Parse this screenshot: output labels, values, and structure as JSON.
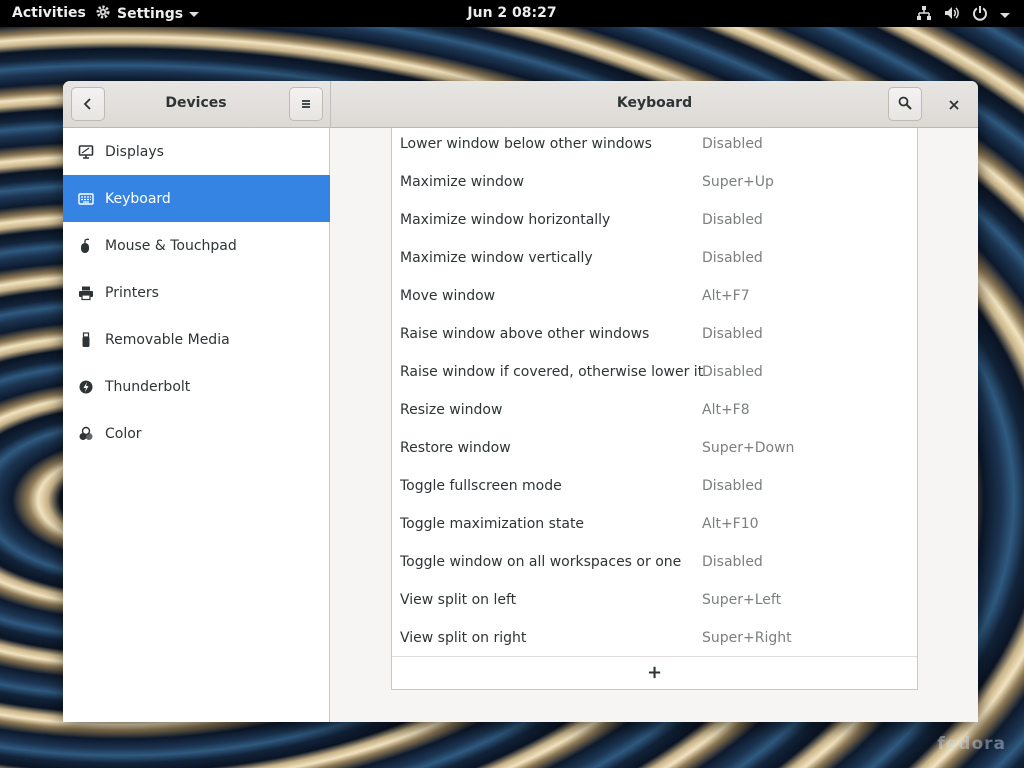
{
  "topbar": {
    "activities": "Activities",
    "app_name": "Settings",
    "clock": "Jun 2  08:27"
  },
  "window": {
    "sidebar_title": "Devices",
    "content_title": "Keyboard",
    "sidebar": {
      "items": [
        {
          "label": "Displays",
          "icon": "display-icon"
        },
        {
          "label": "Keyboard",
          "icon": "keyboard-icon",
          "active": true
        },
        {
          "label": "Mouse & Touchpad",
          "icon": "mouse-icon"
        },
        {
          "label": "Printers",
          "icon": "printer-icon"
        },
        {
          "label": "Removable Media",
          "icon": "usb-icon"
        },
        {
          "label": "Thunderbolt",
          "icon": "thunderbolt-icon"
        },
        {
          "label": "Color",
          "icon": "color-icon"
        }
      ]
    },
    "shortcuts": [
      {
        "name": "Lower window below other windows",
        "accel": "Disabled"
      },
      {
        "name": "Maximize window",
        "accel": "Super+Up"
      },
      {
        "name": "Maximize window horizontally",
        "accel": "Disabled"
      },
      {
        "name": "Maximize window vertically",
        "accel": "Disabled"
      },
      {
        "name": "Move window",
        "accel": "Alt+F7"
      },
      {
        "name": "Raise window above other windows",
        "accel": "Disabled"
      },
      {
        "name": "Raise window if covered, otherwise lower it",
        "accel": "Disabled"
      },
      {
        "name": "Resize window",
        "accel": "Alt+F8"
      },
      {
        "name": "Restore window",
        "accel": "Super+Down"
      },
      {
        "name": "Toggle fullscreen mode",
        "accel": "Disabled"
      },
      {
        "name": "Toggle maximization state",
        "accel": "Alt+F10"
      },
      {
        "name": "Toggle window on all workspaces or one",
        "accel": "Disabled"
      },
      {
        "name": "View split on left",
        "accel": "Super+Left"
      },
      {
        "name": "View split on right",
        "accel": "Super+Right"
      }
    ],
    "add_label": "+"
  },
  "desktop": {
    "watermark": "fedora"
  },
  "colors": {
    "accent": "#3584e4",
    "topbar": "#000000"
  }
}
